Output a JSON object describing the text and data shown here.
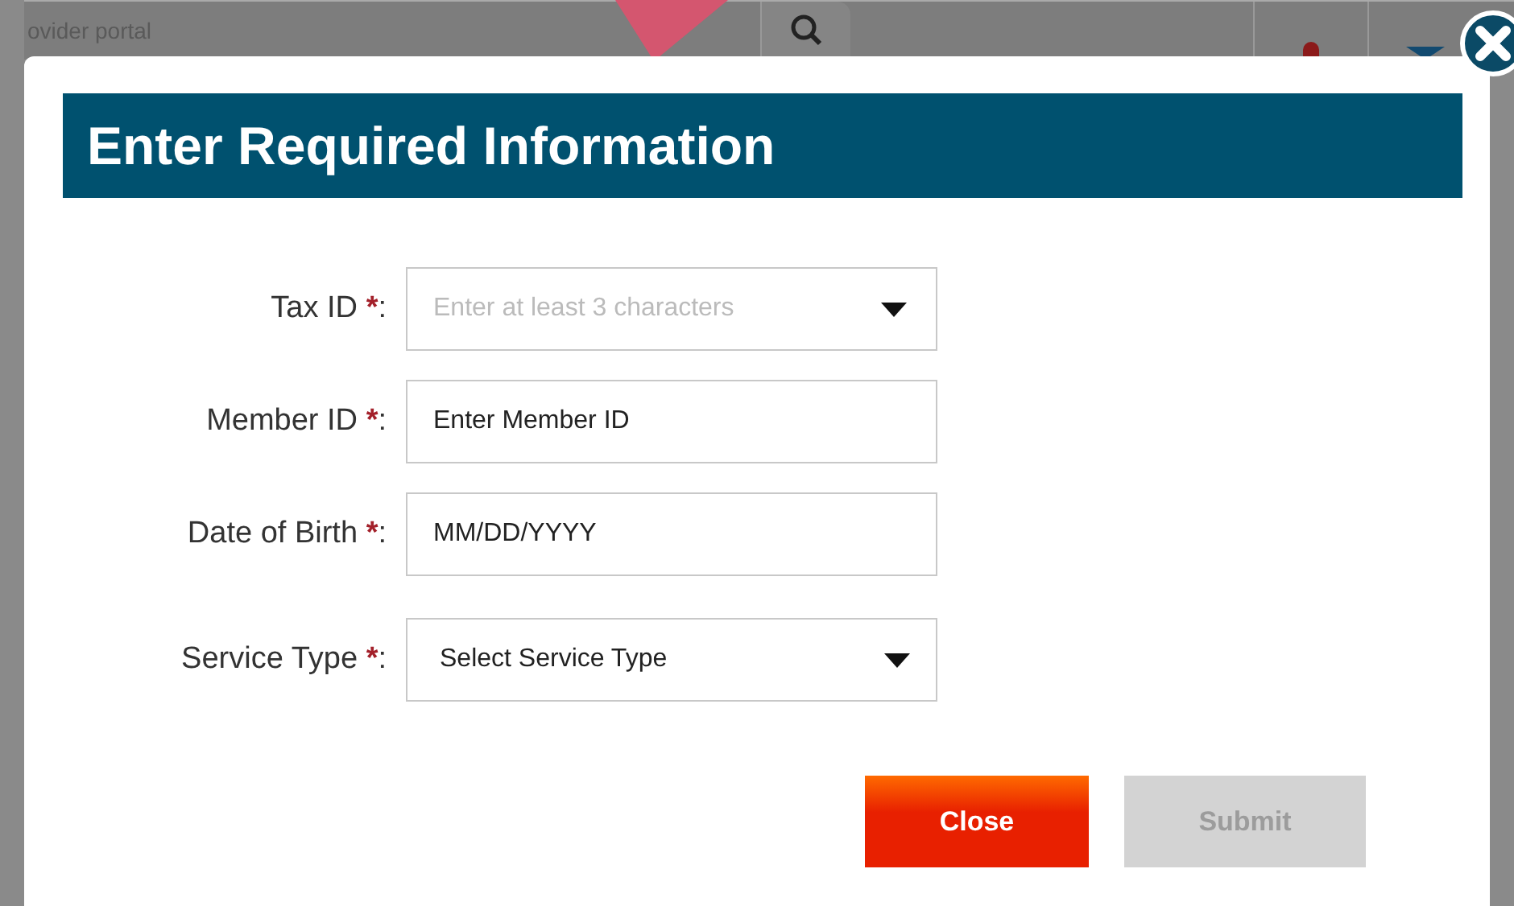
{
  "background": {
    "site_title": "ovider portal"
  },
  "dialog": {
    "title": "Enter Required Information",
    "fields": [
      {
        "label": "Tax ID",
        "required_mark": "*",
        "colon": ":",
        "kind": "combo",
        "placeholder": "Enter at least 3 characters"
      },
      {
        "label": "Member ID",
        "required_mark": "*",
        "colon": ":",
        "kind": "text",
        "placeholder": "Enter Member ID"
      },
      {
        "label": "Date of Birth",
        "required_mark": "*",
        "colon": ":",
        "kind": "text",
        "placeholder": "MM/DD/YYYY"
      },
      {
        "label": "Service Type",
        "required_mark": "*",
        "colon": ":",
        "kind": "select",
        "value": "Select Service Type"
      }
    ],
    "buttons": [
      {
        "label": "Close",
        "disabled": false
      },
      {
        "label": "Submit",
        "disabled": true
      }
    ]
  }
}
